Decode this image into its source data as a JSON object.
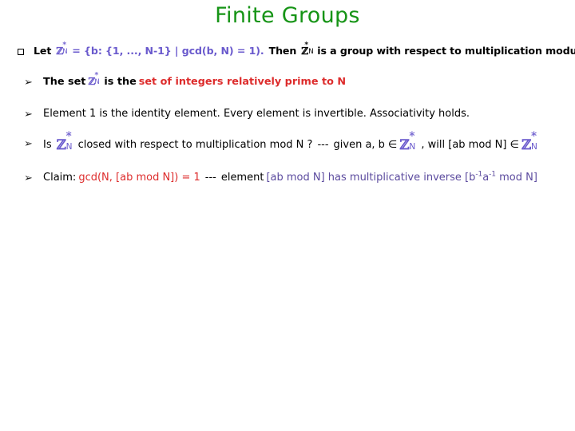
{
  "slide": {
    "title": "Finite Groups",
    "title_color": "#169416",
    "colors": {
      "purple": "#6a5acd",
      "purple_dark": "#5b4a9e",
      "red": "#dd2c2c",
      "black": "#000000",
      "green": "#169416"
    },
    "bullets": [
      {
        "marker": "square-bullet",
        "level": 1,
        "bold": true,
        "plain_text": "Let Z*N = {b: {1, ..., N-1} | gcd(b, N) = 1). Then Z*N is a group with respect to multiplication modulo N",
        "segments": {
          "s1": "Let",
          "z1_base": "ℤ",
          "z1_sup": "*",
          "z1_sub": "N",
          "s2": "= {b: {1, ..., N-1} | gcd(b, N) = 1).",
          "s3": "Then",
          "z2_base": "ℤ",
          "z2_sup": "*",
          "z2_sub": "N",
          "s4": "is a group with respect to multiplication modulo N"
        }
      },
      {
        "marker": "arrow-bullet",
        "level": 2,
        "bold": true,
        "plain_text": "The set Z*N is the set of integers relatively prime to N",
        "segments": {
          "s1": "The set",
          "z_base": "ℤ",
          "z_sup": "*",
          "z_sub": "N",
          "s2": "is the",
          "s3": "set of integers relatively prime to N"
        }
      },
      {
        "marker": "arrow-bullet",
        "level": 2,
        "bold": false,
        "plain_text": "Element 1 is the identity element. Every element is invertible. Associativity holds.",
        "segments": {
          "s1": "Element 1 is the identity element. Every element is invertible. Associativity holds."
        }
      },
      {
        "marker": "arrow-bullet",
        "level": 2,
        "bold": false,
        "plain_text": "Is Z*N closed with respect to multiplication mod N ?  --- given a, b ∈ Z*N , will [ab mod N] ∈ Z*N",
        "segments": {
          "s1": "Is",
          "z1_base": "ℤ",
          "z1_sup": "*",
          "z1_sub": "N",
          "s2": "closed with respect to multiplication mod N ?",
          "s3": "---",
          "s4": "given a, b ∈",
          "z2_base": "ℤ",
          "z2_sup": "*",
          "z2_sub": "N",
          "s5": ", will [ab mod N] ∈",
          "z3_base": "ℤ",
          "z3_sup": "*",
          "z3_sub": "N"
        }
      },
      {
        "marker": "arrow-bullet",
        "level": 2,
        "bold": false,
        "plain_text": "Claim: gcd(N, [ab mod N]) = 1  ---  element [ab mod N] has multiplicative inverse [b-1a-1 mod N]",
        "segments": {
          "s1": "Claim:",
          "s2": "gcd(N, [ab mod N]) = 1",
          "s3": "---",
          "s4": "element",
          "s5": "[ab mod N] has multiplicative inverse [b",
          "exp1": "-1",
          "s6": "a",
          "exp2": "-1",
          "s7": " mod N]"
        }
      }
    ],
    "markers": {
      "square": "❑",
      "arrow": "➢"
    }
  }
}
